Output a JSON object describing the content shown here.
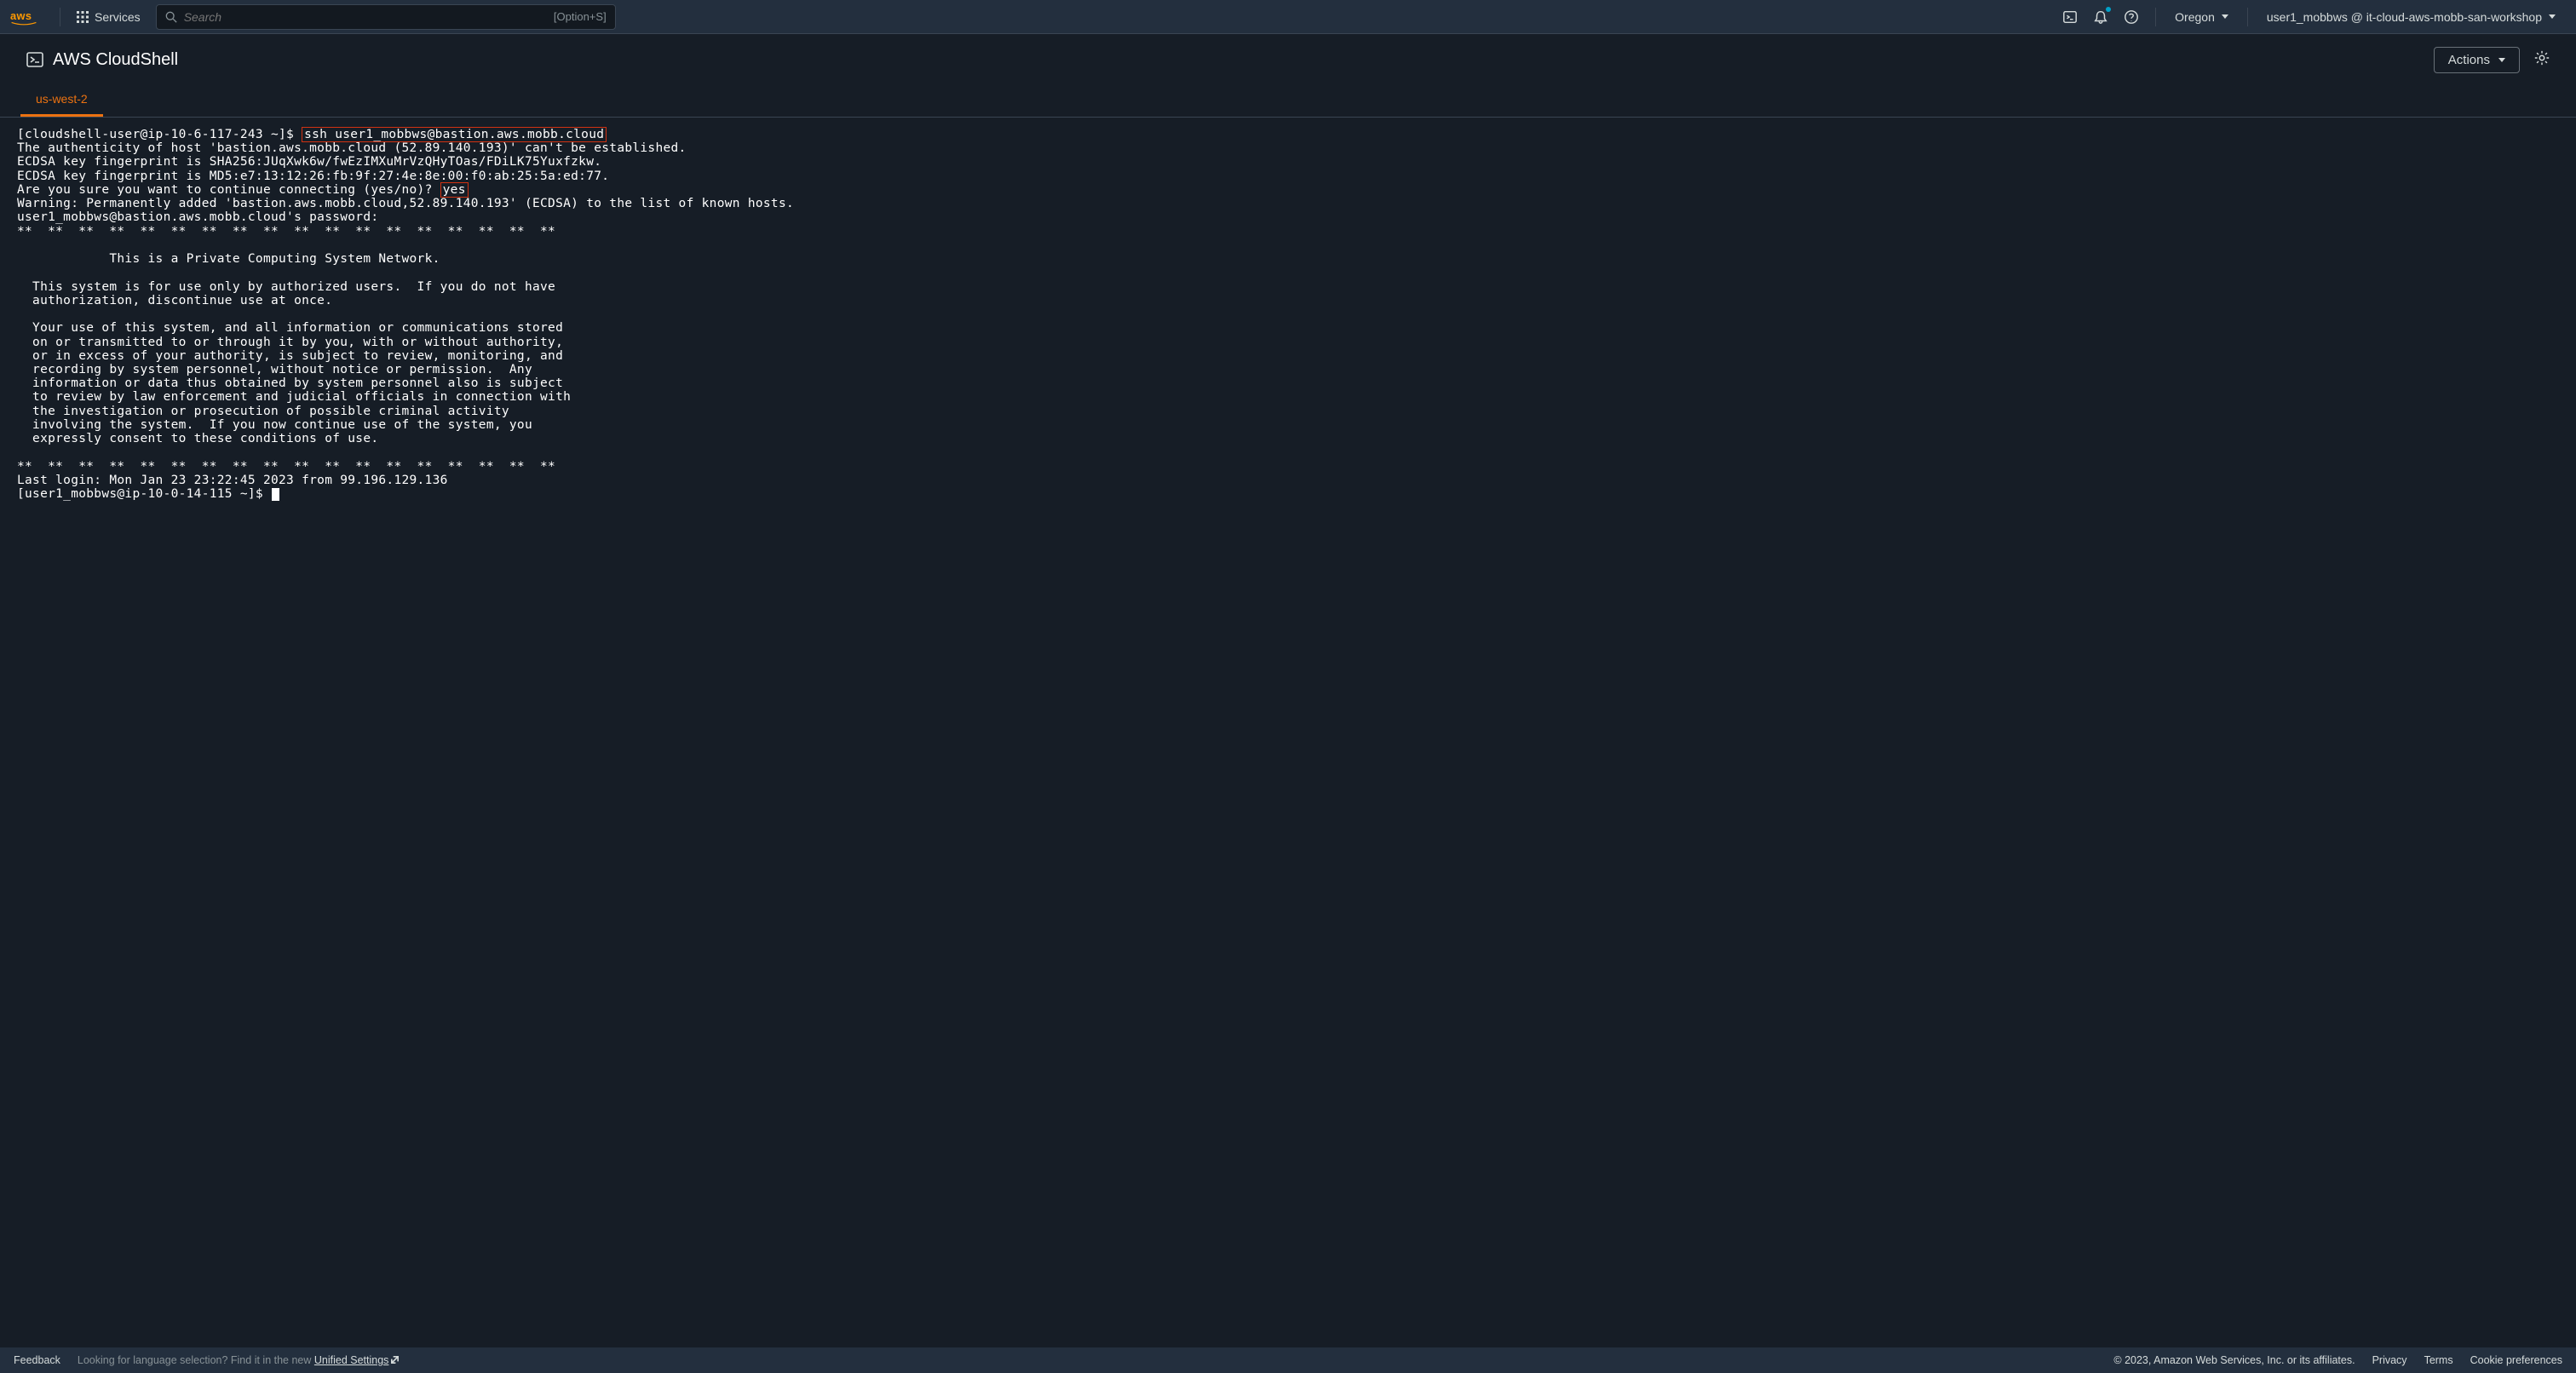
{
  "topnav": {
    "services_label": "Services",
    "search_placeholder": "Search",
    "search_hint": "[Option+S]",
    "region": "Oregon",
    "account": "user1_mobbws @ it-cloud-aws-mobb-san-workshop"
  },
  "subheader": {
    "title": "AWS CloudShell",
    "actions_label": "Actions"
  },
  "tabs": {
    "active": "us-west-2"
  },
  "terminal": {
    "prompt1_prefix": "[cloudshell-user@ip-10-6-117-243 ~]$ ",
    "ssh_cmd": "ssh user1_mobbws@bastion.aws.mobb.cloud",
    "line2": "The authenticity of host 'bastion.aws.mobb.cloud (52.89.140.193)' can't be established.",
    "line3": "ECDSA key fingerprint is SHA256:JUqXwk6w/fwEzIMXuMrVzQHyTOas/FDiLK75Yuxfzkw.",
    "line4": "ECDSA key fingerprint is MD5:e7:13:12:26:fb:9f:27:4e:8e:00:f0:ab:25:5a:ed:77.",
    "line5_prefix": "Are you sure you want to continue connecting (yes/no)? ",
    "yes": "yes",
    "line6": "Warning: Permanently added 'bastion.aws.mobb.cloud,52.89.140.193' (ECDSA) to the list of known hosts.",
    "line7": "user1_mobbws@bastion.aws.mobb.cloud's password:",
    "stars": "**  **  **  **  **  **  **  **  **  **  **  **  **  **  **  **  **  **",
    "banner_title": "            This is a Private Computing System Network.",
    "banner_p1_l1": "  This system is for use only by authorized users.  If you do not have",
    "banner_p1_l2": "  authorization, discontinue use at once.",
    "banner_p2_l1": "  Your use of this system, and all information or communications stored",
    "banner_p2_l2": "  on or transmitted to or through it by you, with or without authority,",
    "banner_p2_l3": "  or in excess of your authority, is subject to review, monitoring, and",
    "banner_p2_l4": "  recording by system personnel, without notice or permission.  Any",
    "banner_p2_l5": "  information or data thus obtained by system personnel also is subject",
    "banner_p2_l6": "  to review by law enforcement and judicial officials in connection with",
    "banner_p2_l7": "  the investigation or prosecution of possible criminal activity",
    "banner_p2_l8": "  involving the system.  If you now continue use of the system, you",
    "banner_p2_l9": "  expressly consent to these conditions of use.",
    "last_login": "Last login: Mon Jan 23 23:22:45 2023 from 99.196.129.136",
    "prompt2": "[user1_mobbws@ip-10-0-14-115 ~]$ "
  },
  "footer": {
    "feedback": "Feedback",
    "lang_hint_prefix": "Looking for language selection? Find it in the new ",
    "lang_hint_link": "Unified Settings",
    "copyright": "© 2023, Amazon Web Services, Inc. or its affiliates.",
    "privacy": "Privacy",
    "terms": "Terms",
    "cookie": "Cookie preferences"
  }
}
